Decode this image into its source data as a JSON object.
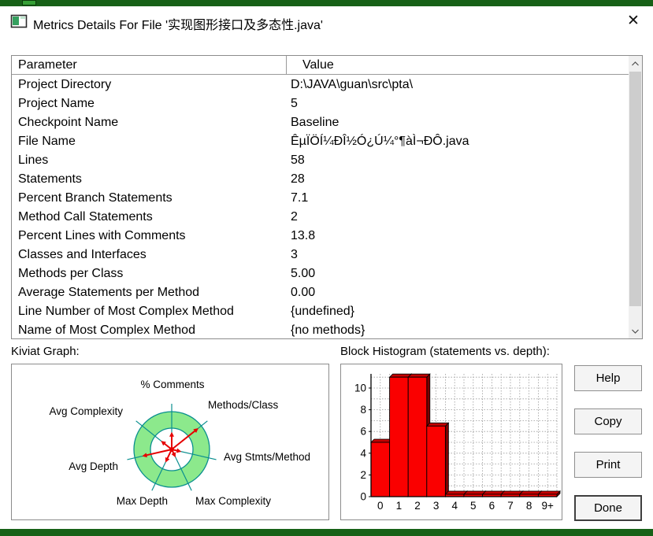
{
  "window": {
    "title": "Metrics Details For File '实现图形接口及多态性.java'",
    "close_glyph": "✕"
  },
  "table": {
    "columns": [
      "Parameter",
      "Value"
    ],
    "rows": [
      [
        "Project Directory",
        "D:\\JAVA\\guan\\src\\pta\\"
      ],
      [
        "Project Name",
        "5"
      ],
      [
        "Checkpoint Name",
        "Baseline"
      ],
      [
        "File Name",
        "ÊµÏÖÍ¼ÐÎ½Ó¿Ú¼°¶àÌ¬ÐÔ.java"
      ],
      [
        "Lines",
        "58"
      ],
      [
        "Statements",
        "28"
      ],
      [
        "Percent Branch Statements",
        "7.1"
      ],
      [
        "Method Call Statements",
        "2"
      ],
      [
        "Percent Lines with Comments",
        "13.8"
      ],
      [
        "Classes and Interfaces",
        "3"
      ],
      [
        "Methods per Class",
        "5.00"
      ],
      [
        "Average Statements per Method",
        "0.00"
      ],
      [
        "Line Number of Most Complex Method",
        "{undefined}"
      ],
      [
        "Name of Most Complex Method",
        "{no methods}"
      ]
    ]
  },
  "kiviat": {
    "label": "Kiviat Graph:",
    "axes": [
      "% Comments",
      "Methods/Class",
      "Avg Stmts/Method",
      "Max Complexity",
      "Max Depth",
      "Avg Depth",
      "Avg Complexity"
    ],
    "values": [
      0.38,
      0.82,
      0.18,
      0.15,
      0.3,
      0.72,
      0.28
    ],
    "ring_color": "#8ce98c",
    "axis_color": "#0a8f8f",
    "arrow_color": "#e60000"
  },
  "histogram": {
    "label": "Block Histogram (statements vs. depth):",
    "chart_data": {
      "type": "bar",
      "categories": [
        "0",
        "1",
        "2",
        "3",
        "4",
        "5",
        "6",
        "7",
        "8",
        "9+"
      ],
      "values": [
        5,
        11,
        11,
        6.5,
        0,
        0,
        0,
        0,
        0,
        0
      ],
      "ylim": [
        0,
        11.3
      ],
      "yticks": [
        0,
        2,
        4,
        6,
        8,
        10
      ],
      "bar_color": "#fa0000",
      "grid": true,
      "legend": false
    }
  },
  "buttons": {
    "help": "Help",
    "copy": "Copy",
    "print": "Print",
    "done": "Done"
  }
}
